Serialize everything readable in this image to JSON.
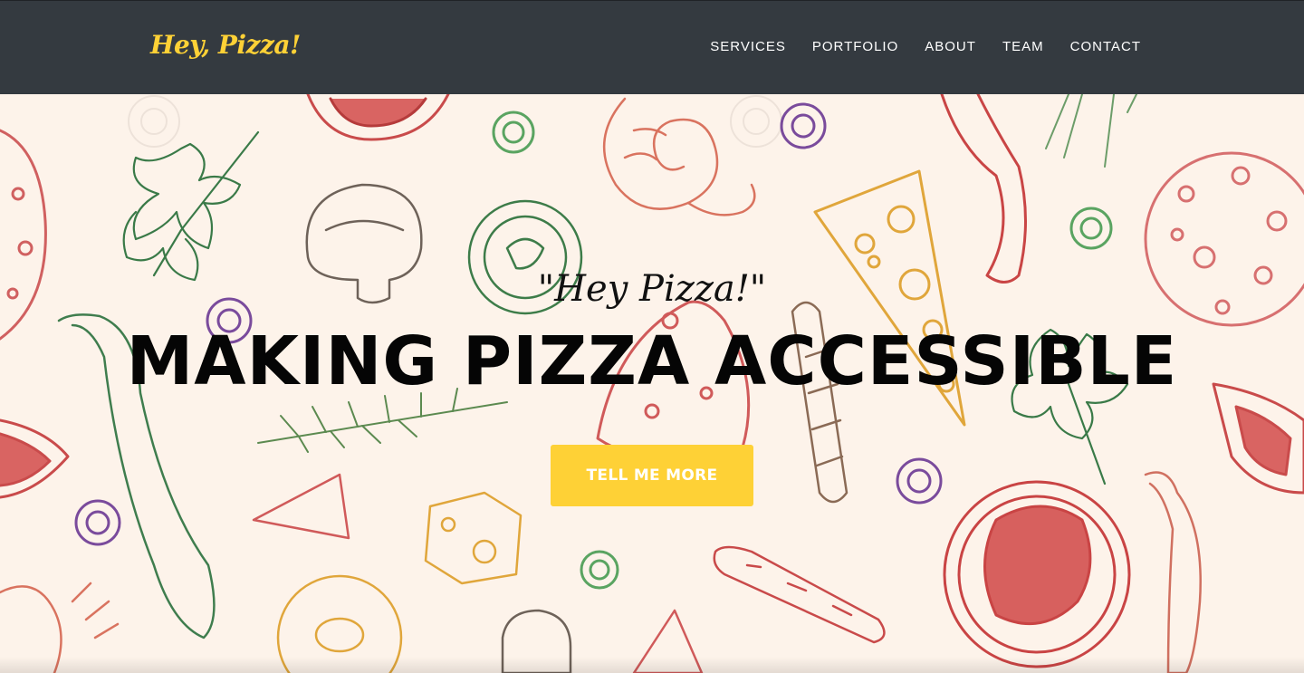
{
  "navbar": {
    "brand": "Hey, Pizza!",
    "brand_color": "#fed136",
    "background": "#343a40",
    "links": [
      {
        "label": "SERVICES"
      },
      {
        "label": "PORTFOLIO"
      },
      {
        "label": "ABOUT"
      },
      {
        "label": "TEAM"
      },
      {
        "label": "CONTACT"
      }
    ]
  },
  "hero": {
    "subheading": "\"Hey Pizza!\"",
    "heading": "MAKING PIZZA ACCESSIBLE",
    "button_label": "TELL ME MORE",
    "button_color": "#fed136",
    "background_color": "#fdf3ea",
    "background_illustration": "hand-drawn pizza ingredients pattern"
  }
}
